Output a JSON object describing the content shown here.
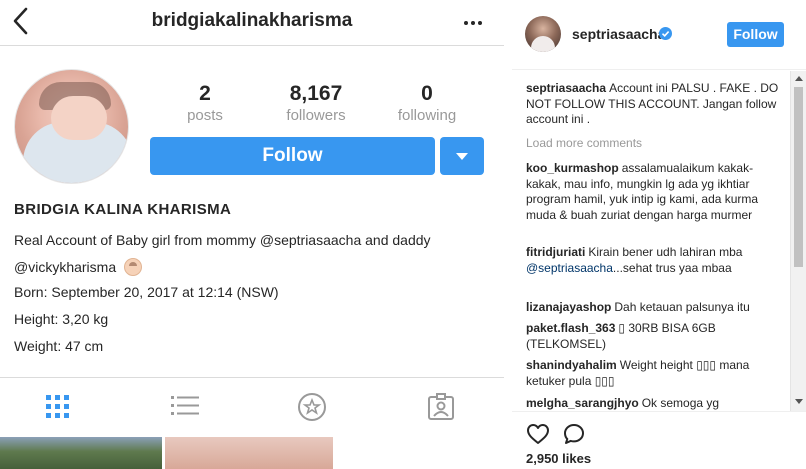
{
  "profile": {
    "username": "bridgiakalinakharisma",
    "stats": [
      {
        "value": "2",
        "label": "posts"
      },
      {
        "value": "8,167",
        "label": "followers"
      },
      {
        "value": "0",
        "label": "following"
      }
    ],
    "follow_label": "Follow",
    "display_name": "BRIDGIA KALINA KHARISMA",
    "bio_lines": [
      "Real Account of Baby girl from mommy @septriasaacha and daddy",
      "@vickykharisma",
      "Born: September 20, 2017 at 12:14 (NSW)",
      "Height: 3,20 kg",
      "Weight: 47 cm"
    ],
    "tabs": [
      "grid-icon",
      "list-icon",
      "saved-star-icon",
      "tagged-icon"
    ],
    "accent_color": "#3897f0"
  },
  "post": {
    "author": "septriasaacha",
    "follow_label": "Follow",
    "caption": {
      "user": "septriasaacha",
      "text": "Account ini PALSU . FAKE . DO NOT FOLLOW THIS ACCOUNT. Jangan follow account ini ."
    },
    "load_more": "Load more comments",
    "comments": [
      {
        "user": "koo_kurmashop",
        "text": "assalamualaikum kakak-kakak, mau info, mungkin lg ada yg ikhtiar program hamil, yuk intip ig kami, ada kurma muda & buah zuriat dengan harga murmer"
      },
      {
        "user": "fitridjuriati",
        "text_before": "Kirain bener udh lahiran mba ",
        "mention": "@septriasaacha",
        "text_after": "...sehat trus yaa mbaa"
      },
      {
        "user": "lizanajayashop",
        "text": "Dah ketauan palsunya itu"
      },
      {
        "user": "paket.flash_363",
        "text": "▯ 30RB BISA 6GB (TELKOMSEL)"
      },
      {
        "user": "shanindyahalim",
        "text": "Weight height ▯▯▯ mana ketuker pula ▯▯▯"
      },
      {
        "user": "melgha_sarangjhyo",
        "text": "Ok semoga yg"
      }
    ],
    "likes": "2,950 likes"
  }
}
